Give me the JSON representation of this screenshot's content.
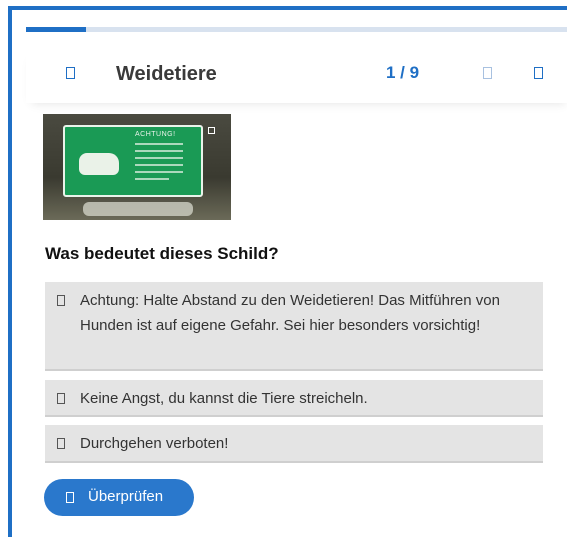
{
  "progress": {
    "current": 1,
    "total": 9,
    "fraction": 0.111
  },
  "header": {
    "title": "Weidetiere",
    "counter": "1 / 9",
    "menu_icon": "menu-icon",
    "prev_icon": "previous-arrow-icon",
    "next_icon": "next-arrow-icon"
  },
  "image": {
    "sign_heading": "ACHTUNG!",
    "expand_icon": "expand-icon"
  },
  "question": "Was bedeutet dieses Schild?",
  "answers": [
    {
      "label": "Achtung: Halte Abstand zu den Weidetieren! Das Mitführen von Hunden ist auf eigene Gefahr. Sei hier besonders vorsichtig!"
    },
    {
      "label": "Keine Angst, du kannst die Tiere streicheln."
    },
    {
      "label": "Durchgehen verboten!"
    }
  ],
  "check_button": {
    "label": "Überprüfen",
    "icon": "check-icon"
  },
  "colors": {
    "accent": "#1f6fc5",
    "button": "#2a78cc",
    "answer_bg": "#e4e4e4",
    "sign_green": "#1a9a55"
  }
}
